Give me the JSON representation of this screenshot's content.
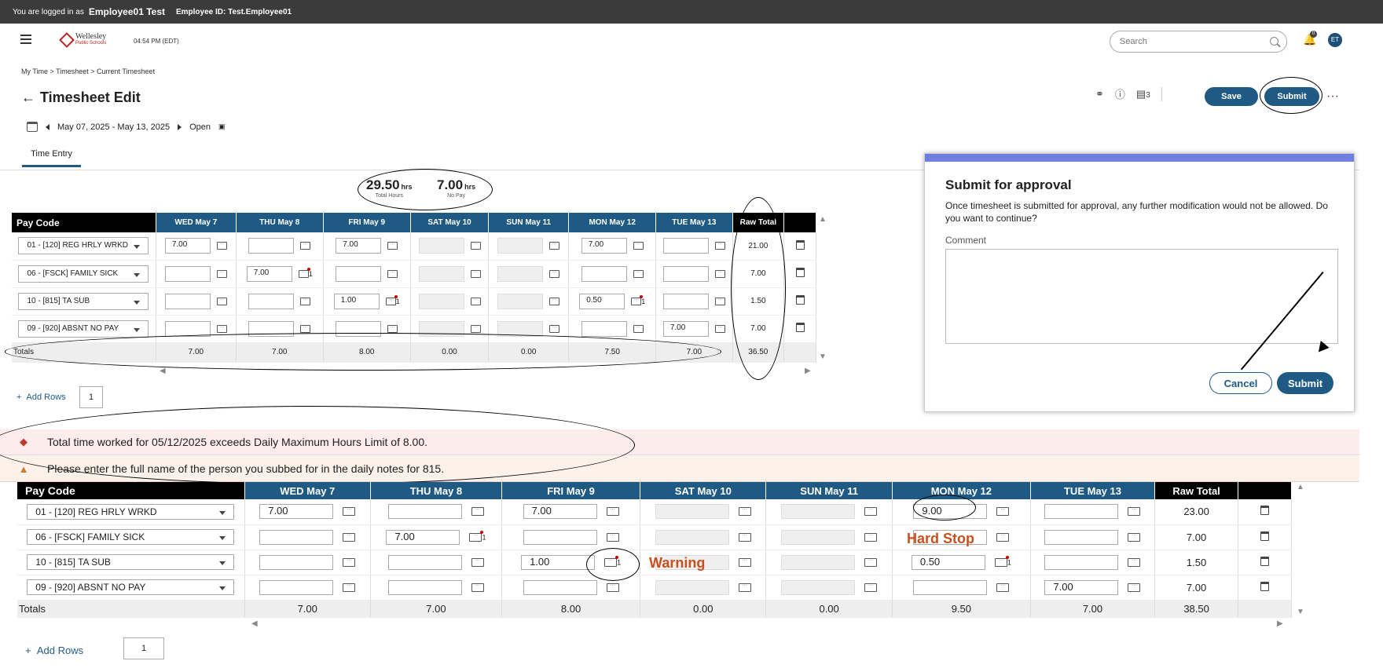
{
  "topbar": {
    "logged_prefix": "You are logged in as",
    "user": "Employee01 Test",
    "employee_id": "Employee ID: Test.Employee01"
  },
  "header": {
    "logo_name": "Wellesley",
    "logo_sub": "Public Schools",
    "time": "04:54 PM (EDT)",
    "search_placeholder": "Search",
    "notif_count": "0",
    "avatar": "ET"
  },
  "breadcrumb": "My Time > Timesheet > Current Timesheet",
  "page_title": "Timesheet Edit",
  "actions": {
    "comments_count": "3",
    "save": "Save",
    "submit": "Submit",
    "more": "···"
  },
  "period": {
    "range": "May 07, 2025 - May 13, 2025",
    "status": "Open"
  },
  "tabs": {
    "time_entry": "Time Entry"
  },
  "summary": {
    "total_hours": "29.50",
    "total_unit": "hrs",
    "total_caption": "Total Hours",
    "nopay_hours": "7.00",
    "nopay_unit": "hrs",
    "nopay_caption": "No Pay"
  },
  "grid1": {
    "headers": [
      "Pay Code",
      "WED May 7",
      "THU May 8",
      "FRI May 9",
      "SAT May 10",
      "SUN May 11",
      "MON May 12",
      "TUE May 13",
      "Raw Total"
    ],
    "rows": [
      {
        "code": "01 - [120] REG HRLY WRKD",
        "cells": [
          "7.00",
          "",
          "7.00",
          "",
          "",
          "7.00",
          ""
        ],
        "total": "21.00"
      },
      {
        "code": "06 - [FSCK] FAMILY SICK",
        "cells": [
          "",
          "7.00",
          "",
          "",
          "",
          "",
          ""
        ],
        "total": "7.00"
      },
      {
        "code": "10 - [815] TA SUB",
        "cells": [
          "",
          "",
          "1.00",
          "",
          "",
          "0.50",
          ""
        ],
        "total": "1.50"
      },
      {
        "code": "09 - [920] ABSNT NO PAY",
        "cells": [
          "",
          "",
          "",
          "",
          "",
          "",
          "7.00"
        ],
        "total": "7.00"
      }
    ],
    "totals_label": "Totals",
    "totals": [
      "7.00",
      "7.00",
      "8.00",
      "0.00",
      "0.00",
      "7.50",
      "7.00"
    ],
    "grand_total": "36.50",
    "add_rows": "Add Rows",
    "add_count": "1",
    "note_count": "1"
  },
  "alerts": {
    "error": "Total time worked for 05/12/2025 exceeds Daily Maximum Hours Limit of 8.00.",
    "warning": "Please enter the full name of the person you subbed for in the daily notes for 815."
  },
  "grid2": {
    "headers": [
      "Pay Code",
      "WED May 7",
      "THU May 8",
      "FRI May 9",
      "SAT May 10",
      "SUN May 11",
      "MON May 12",
      "TUE May 13",
      "Raw Total"
    ],
    "rows": [
      {
        "code": "01 - [120] REG HRLY WRKD",
        "cells": [
          "7.00",
          "",
          "7.00",
          "",
          "",
          "9.00",
          ""
        ],
        "total": "23.00"
      },
      {
        "code": "06 - [FSCK] FAMILY SICK",
        "cells": [
          "",
          "7.00",
          "",
          "",
          "",
          "",
          ""
        ],
        "total": "7.00"
      },
      {
        "code": "10 - [815] TA SUB",
        "cells": [
          "",
          "",
          "1.00",
          "",
          "",
          "0.50",
          ""
        ],
        "total": "1.50"
      },
      {
        "code": "09 - [920] ABSNT NO PAY",
        "cells": [
          "",
          "",
          "",
          "",
          "",
          "",
          "7.00"
        ],
        "total": "7.00"
      }
    ],
    "totals_label": "Totals",
    "totals": [
      "7.00",
      "7.00",
      "8.00",
      "0.00",
      "0.00",
      "9.50",
      "7.00"
    ],
    "grand_total": "38.50",
    "add_rows": "Add Rows",
    "add_count": "1",
    "note_count": "1"
  },
  "annotations": {
    "hard_stop": "Hard Stop",
    "warning": "Warning"
  },
  "dialog": {
    "title": "Submit for approval",
    "message": "Once timesheet is submitted for approval, any further modification would not be allowed. Do you want to continue?",
    "comment_label": "Comment",
    "cancel": "Cancel",
    "submit": "Submit"
  },
  "colors": {
    "primary": "#1f5a85",
    "error_bg": "#fcecec",
    "warning_bg": "#fdf2ea",
    "annotation": "#c8501e"
  }
}
